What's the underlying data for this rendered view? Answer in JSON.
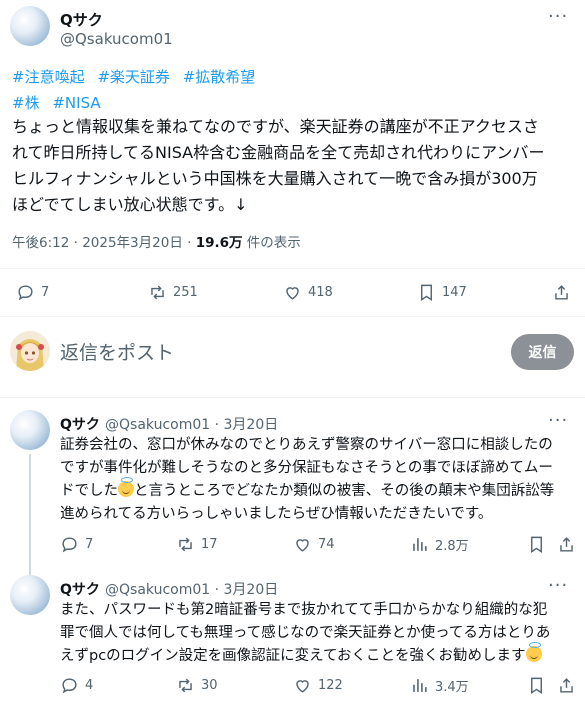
{
  "tweet": {
    "display_name": "Qサク",
    "handle": "@Qsakucom01",
    "more_label": "···",
    "hashtags_line1": [
      "#注意喚起",
      "#楽天証券",
      "#拡散希望"
    ],
    "hashtags_line2": [
      "#株",
      "#NISA"
    ],
    "text_lines": [
      "ちょっと情報収集を兼ねてなのですが、楽天証券の講座が不正アクセスさ",
      "れて昨日所持してるNISA枠含む金融商品を全て売却され代わりにアンバー",
      "ヒルフィナンシャルという中国株を大量購入されて一晩で含み損が300万",
      "ほどでてしまい放心状態です。↓"
    ],
    "time": "午後6:12 · 2025年3月20日 · ",
    "views_count": "19.6万",
    "views_label": " 件の表示",
    "stats": {
      "replies": "7",
      "reposts": "251",
      "likes": "418",
      "bookmarks": "147"
    }
  },
  "compose": {
    "placeholder": "返信をポスト",
    "button_label": "返信"
  },
  "replies": [
    {
      "display_name": "Qサク",
      "handle_date": "@Qsakucom01 · 3月20日",
      "lines": [
        "証券会社の、窓口が休みなのでとりあえず警察のサイバー窓口に相談したの",
        "ですが事件化が難しそうなのと多分保証もなさそうとの事でほぼ諦めてムー",
        "ドでした",
        "と言うところでどなたか類似の被害、その後の顛末や集団訴訟等",
        "進められてる方いらっしゃいましたらぜひ情報いただきたいです。"
      ],
      "stats": {
        "replies": "7",
        "reposts": "17",
        "likes": "74",
        "views": "2.8万"
      }
    },
    {
      "display_name": "Qサク",
      "handle_date": "@Qsakucom01 · 3月20日",
      "lines": [
        "また、パスワードも第2暗証番号まで抜かれてて手口からかなり組織的な犯",
        "罪で個人では何しても無理って感じなので楽天証券とか使ってる方はとりあ",
        "えずpcのログイン設定を画像認証に変えておくことを強くお勧めします"
      ],
      "stats": {
        "replies": "4",
        "reposts": "30",
        "likes": "122",
        "views": "3.4万"
      }
    }
  ]
}
